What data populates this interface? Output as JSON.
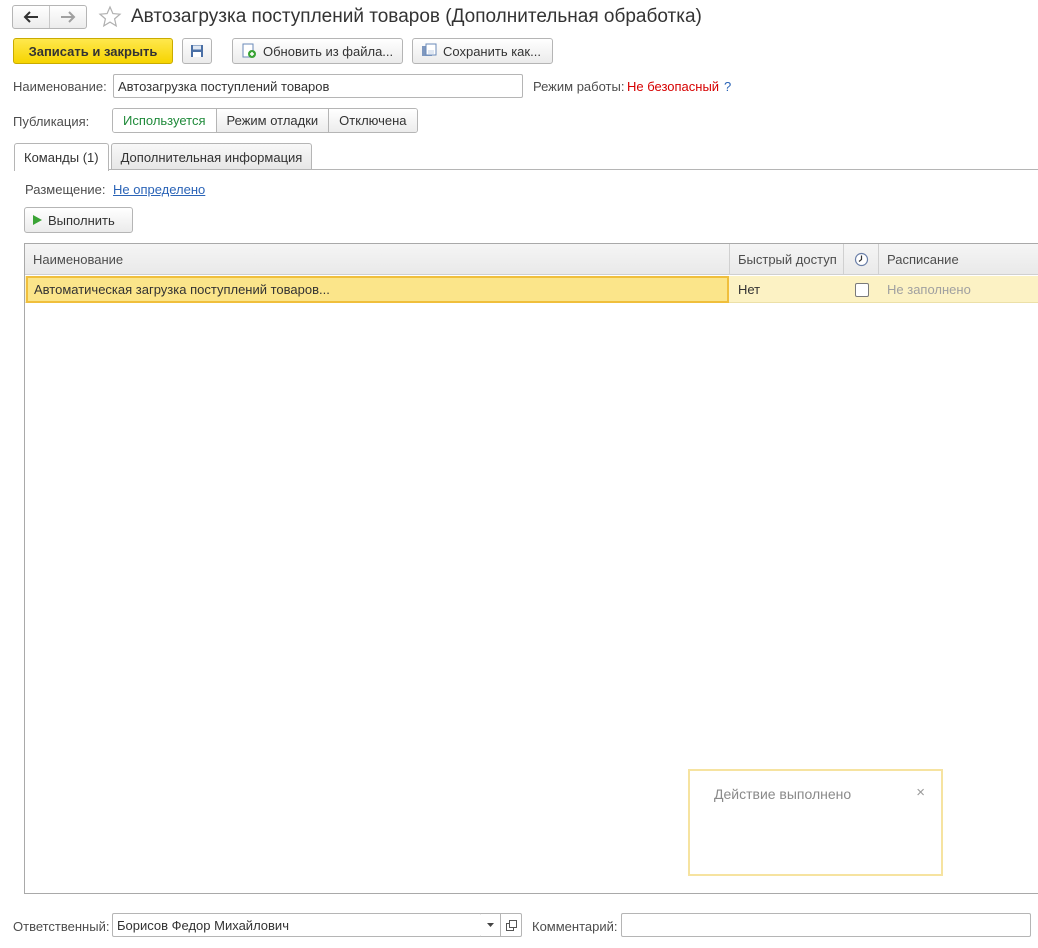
{
  "window": {
    "title": "Автозагрузка поступлений товаров (Дополнительная обработка)"
  },
  "toolbar": {
    "save_close_label": "Записать и закрыть",
    "refresh_label": "Обновить из файла...",
    "save_as_label": "Сохранить как..."
  },
  "form": {
    "name_label": "Наименование:",
    "name_value": "Автозагрузка поступлений товаров",
    "mode_label": "Режим работы:",
    "mode_value": "Не безопасный",
    "help_label": "?",
    "publication_label": "Публикация:",
    "publication_options": [
      "Используется",
      "Режим отладки",
      "Отключена"
    ],
    "publication_selected": "Используется"
  },
  "tabs": [
    {
      "label": "Команды (1)",
      "active": true
    },
    {
      "label": "Дополнительная информация",
      "active": false
    }
  ],
  "commands": {
    "placement_label": "Размещение:",
    "placement_value": "Не определено",
    "run_label": "Выполнить",
    "columns": [
      "Наименование",
      "Быстрый доступ",
      "",
      "Расписание"
    ],
    "rows": [
      {
        "name": "Автоматическая загрузка поступлений товаров...",
        "quick_access": "Нет",
        "scheduled": false,
        "schedule": "Не заполнено"
      }
    ]
  },
  "notification": {
    "text": "Действие выполнено",
    "close": "×"
  },
  "footer": {
    "responsible_label": "Ответственный:",
    "responsible_value": "Борисов Федор Михайлович",
    "comment_label": "Комментарий:",
    "comment_value": ""
  },
  "colors": {
    "primary_button": "#f6d400",
    "selected_row": "#fcf2c4",
    "link": "#2b64b7",
    "danger": "#d60000",
    "active_option": "#1f8a3a"
  },
  "icons": [
    "arrow-left-icon",
    "arrow-right-icon",
    "star-icon",
    "floppy-disk-icon",
    "refresh-file-icon",
    "save-as-icon",
    "play-icon",
    "clock-icon",
    "chevron-down-icon",
    "open-window-icon",
    "close-icon"
  ]
}
